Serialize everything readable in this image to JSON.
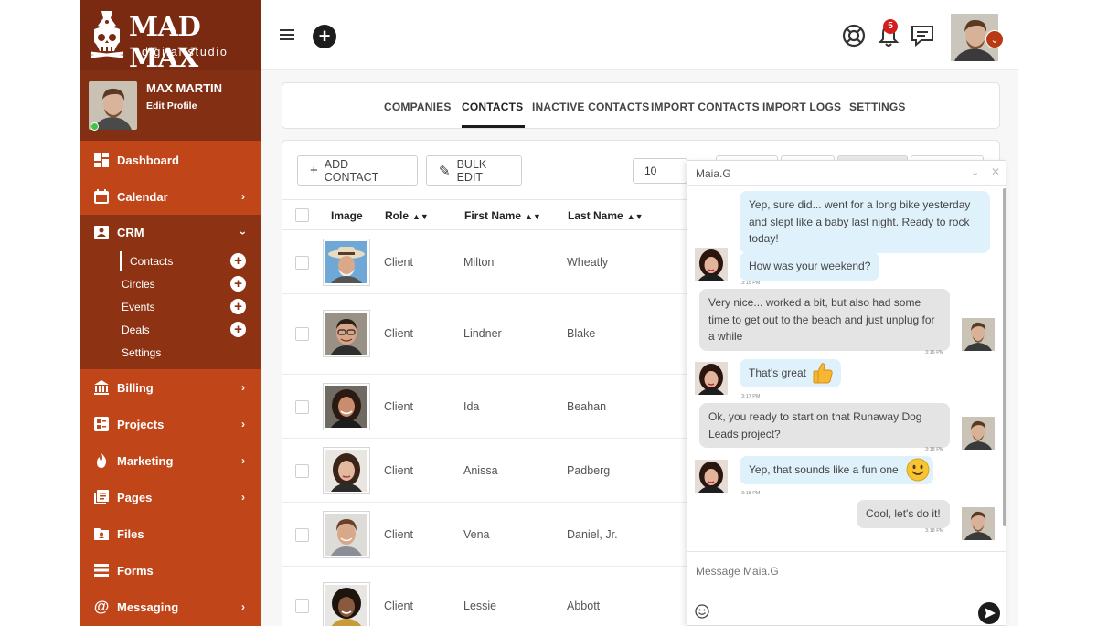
{
  "brand": {
    "name": "MAD MAX",
    "tagline": "digital studio"
  },
  "profile": {
    "name": "MAX MARTIN",
    "edit_label": "Edit Profile",
    "status": "online"
  },
  "nav": {
    "dashboard": "Dashboard",
    "calendar": "Calendar",
    "crm": "CRM",
    "crm_sub": [
      "Contacts",
      "Circles",
      "Events",
      "Deals",
      "Settings"
    ],
    "billing": "Billing",
    "projects": "Projects",
    "marketing": "Marketing",
    "pages": "Pages",
    "files": "Files",
    "forms": "Forms",
    "messaging": "Messaging"
  },
  "topbar": {
    "notification_count": "5"
  },
  "tabs": [
    "COMPANIES",
    "CONTACTS",
    "INACTIVE CONTACTS",
    "IMPORT CONTACTS",
    "IMPORT LOGS",
    "SETTINGS"
  ],
  "toolbar": {
    "add_contact": "ADD CONTACT",
    "bulk_edit": "BULK EDIT",
    "per_page": "10"
  },
  "table": {
    "headers": {
      "image": "Image",
      "role": "Role",
      "first_name": "First Name",
      "last_name": "Last Name"
    },
    "rows": [
      {
        "role": "Client",
        "first": "Milton",
        "last": "Wheatly"
      },
      {
        "role": "Client",
        "first": "Lindner",
        "last": "Blake"
      },
      {
        "role": "Client",
        "first": "Ida",
        "last": "Beahan"
      },
      {
        "role": "Client",
        "first": "Anissa",
        "last": "Padberg"
      },
      {
        "role": "Client",
        "first": "Vena",
        "last": "Daniel, Jr."
      },
      {
        "role": "Client",
        "first": "Lessie",
        "last": "Abbott"
      }
    ]
  },
  "chat": {
    "title": "Maia.G",
    "input_placeholder": "Message Maia.G",
    "messages": [
      {
        "text": "Yep, sure did... went for a long bike yesterday and slept like a baby last night. Ready to rock today!"
      },
      {
        "text": "How was your weekend?",
        "time": "3:15 PM"
      },
      {
        "text": "Very nice... worked a bit, but also had some time to get out to the beach and just unplug for a while",
        "time": "3:16 PM"
      },
      {
        "text": "That's great",
        "time": "3:17 PM"
      },
      {
        "text": "Ok, you ready to start on that Runaway Dog Leads project?",
        "time": "3:18 PM"
      },
      {
        "text": "Yep, that sounds like a fun one",
        "time": "3:18 PM"
      },
      {
        "text": "Cool, let's do it!",
        "time": "3:18 PM"
      }
    ]
  }
}
